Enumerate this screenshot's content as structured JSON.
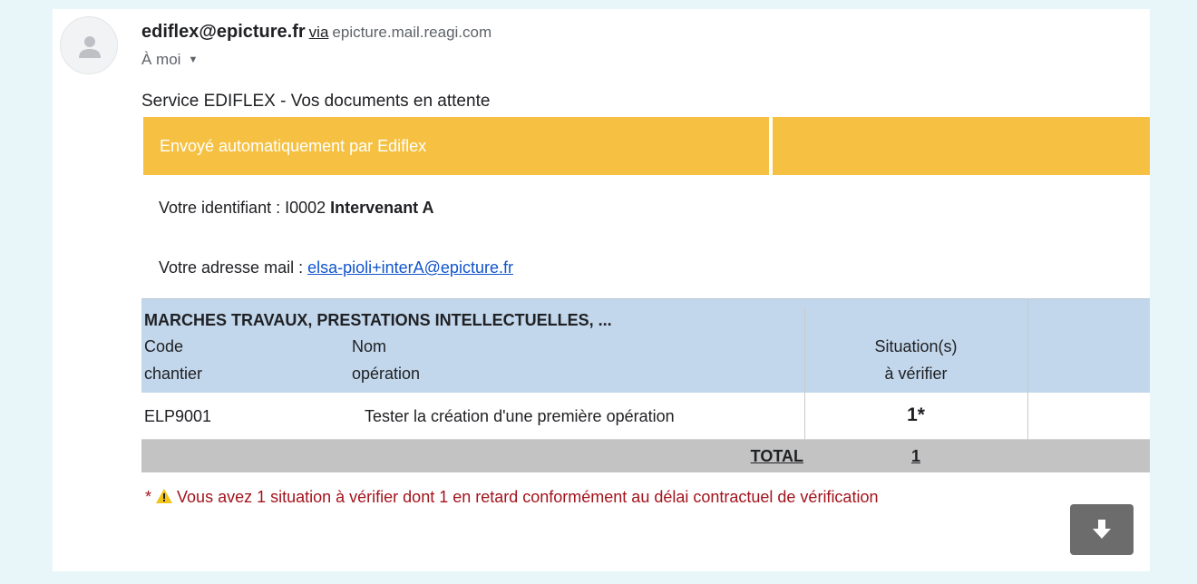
{
  "sender": {
    "email": "ediflex@epicture.fr",
    "via": "via",
    "domain": "epicture.mail.reagi.com",
    "recipient": "À moi"
  },
  "message": {
    "subject": "Service EDIFLEX - Vos documents en attente",
    "banner_text": "Envoyé automatiquement par Ediflex",
    "banner_color": "#f6c143",
    "id_label": "Votre identifiant : ",
    "id_value": "I0002",
    "id_name": "Intervenant A",
    "mail_label": "Votre adresse mail : ",
    "mail_value": "elsa-pioli+interA@epicture.fr"
  },
  "table": {
    "section_title": "MARCHES TRAVAUX, PRESTATIONS INTELLECTUELLES, ...",
    "headers": {
      "code_line1": "Code",
      "code_line2": "chantier",
      "name_line1": "Nom",
      "name_line2": "opération",
      "situation_line1": "Situation(s)",
      "situation_line2": "à vérifier"
    },
    "rows": [
      {
        "code": "ELP9001",
        "name": "Tester la création d'une première opération",
        "situations": "1*"
      }
    ],
    "total_label": "TOTAL",
    "total_value": "1",
    "header_color": "#c2d7ec",
    "footer_color": "#c3c3c3"
  },
  "warning": {
    "prefix": "* ",
    "icon": "warning-icon",
    "text": "Vous avez 1 situation à vérifier dont 1 en retard conformément au délai contractuel de vérification",
    "color": "#a3131c"
  },
  "icons": {
    "avatar": "person-icon",
    "menu_caret": "caret-down-icon",
    "download": "download-arrow-icon"
  }
}
